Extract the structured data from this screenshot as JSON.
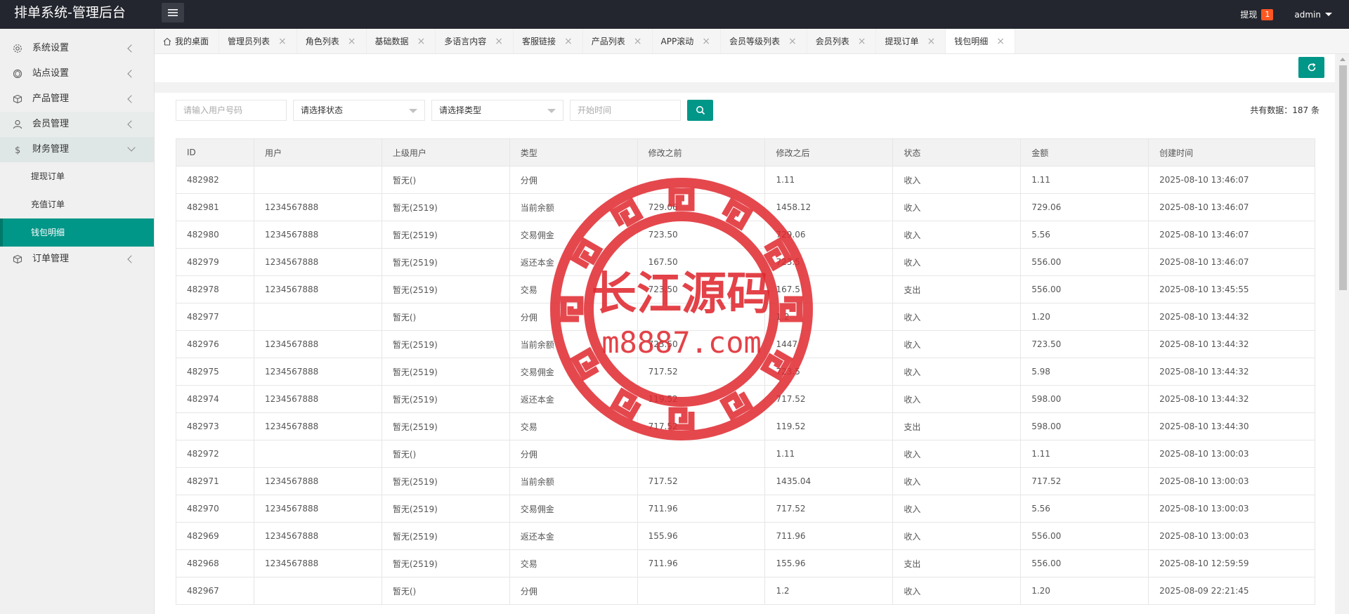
{
  "app": {
    "title": "排单系统-管理后台"
  },
  "topbar": {
    "withdraw_label": "提现",
    "withdraw_badge": "1",
    "user": "admin"
  },
  "sidebar": {
    "groups": [
      {
        "label": "系统设置",
        "icon": "gear-icon"
      },
      {
        "label": "站点设置",
        "icon": "site-icon"
      },
      {
        "label": "产品管理",
        "icon": "box-icon"
      },
      {
        "label": "会员管理",
        "icon": "user-icon"
      },
      {
        "label": "财务管理",
        "icon": "dollar-icon"
      },
      {
        "label": "订单管理",
        "icon": "box-icon"
      }
    ],
    "finance_items": [
      {
        "label": "提现订单"
      },
      {
        "label": "充值订单"
      },
      {
        "label": "钱包明细"
      }
    ]
  },
  "tabs": [
    {
      "label": "我的桌面"
    },
    {
      "label": "管理员列表"
    },
    {
      "label": "角色列表"
    },
    {
      "label": "基础数据"
    },
    {
      "label": "多语言内容"
    },
    {
      "label": "客服链接"
    },
    {
      "label": "产品列表"
    },
    {
      "label": "APP滚动"
    },
    {
      "label": "会员等级列表"
    },
    {
      "label": "会员列表"
    },
    {
      "label": "提现订单"
    },
    {
      "label": "钱包明细"
    }
  ],
  "filters": {
    "user_placeholder": "请输入用户号码",
    "status_select": "请选择状态",
    "type_select": "请选择类型",
    "time_placeholder": "开始时间"
  },
  "total_text": "共有数据：187 条",
  "table": {
    "headers": [
      "ID",
      "用户",
      "上级用户",
      "类型",
      "修改之前",
      "修改之后",
      "状态",
      "金额",
      "创建时间"
    ],
    "rows": [
      [
        "482982",
        "",
        "暂无()",
        "分佣",
        "",
        "1.11",
        "收入",
        "1.11",
        "2025-08-10 13:46:07"
      ],
      [
        "482981",
        "1234567888",
        "暂无(2519)",
        "当前余额",
        "729.06",
        "1458.12",
        "收入",
        "729.06",
        "2025-08-10 13:46:07"
      ],
      [
        "482980",
        "1234567888",
        "暂无(2519)",
        "交易佣金",
        "723.50",
        "729.06",
        "收入",
        "5.56",
        "2025-08-10 13:46:07"
      ],
      [
        "482979",
        "1234567888",
        "暂无(2519)",
        "返还本金",
        "167.50",
        "723.5",
        "收入",
        "556.00",
        "2025-08-10 13:46:07"
      ],
      [
        "482978",
        "1234567888",
        "暂无(2519)",
        "交易",
        "723.50",
        "167.5",
        "支出",
        "556.00",
        "2025-08-10 13:45:55"
      ],
      [
        "482977",
        "",
        "暂无()",
        "分佣",
        "",
        "1.2",
        "收入",
        "1.20",
        "2025-08-10 13:44:32"
      ],
      [
        "482976",
        "1234567888",
        "暂无(2519)",
        "当前余额",
        "723.50",
        "1447",
        "收入",
        "723.50",
        "2025-08-10 13:44:32"
      ],
      [
        "482975",
        "1234567888",
        "暂无(2519)",
        "交易佣金",
        "717.52",
        "723.5",
        "收入",
        "5.98",
        "2025-08-10 13:44:32"
      ],
      [
        "482974",
        "1234567888",
        "暂无(2519)",
        "返还本金",
        "119.52",
        "717.52",
        "收入",
        "598.00",
        "2025-08-10 13:44:32"
      ],
      [
        "482973",
        "1234567888",
        "暂无(2519)",
        "交易",
        "717.52",
        "119.52",
        "支出",
        "598.00",
        "2025-08-10 13:44:30"
      ],
      [
        "482972",
        "",
        "暂无()",
        "分佣",
        "",
        "1.11",
        "收入",
        "1.11",
        "2025-08-10 13:00:03"
      ],
      [
        "482971",
        "1234567888",
        "暂无(2519)",
        "当前余额",
        "717.52",
        "1435.04",
        "收入",
        "717.52",
        "2025-08-10 13:00:03"
      ],
      [
        "482970",
        "1234567888",
        "暂无(2519)",
        "交易佣金",
        "711.96",
        "717.52",
        "收入",
        "5.56",
        "2025-08-10 13:00:03"
      ],
      [
        "482969",
        "1234567888",
        "暂无(2519)",
        "返还本金",
        "155.96",
        "711.96",
        "收入",
        "556.00",
        "2025-08-10 13:00:03"
      ],
      [
        "482968",
        "1234567888",
        "暂无(2519)",
        "交易",
        "711.96",
        "155.96",
        "支出",
        "556.00",
        "2025-08-10 12:59:59"
      ],
      [
        "482967",
        "",
        "暂无()",
        "分佣",
        "",
        "1.2",
        "收入",
        "1.20",
        "2025-08-09 22:21:45"
      ]
    ]
  },
  "watermark": {
    "title": "长江源码",
    "url": "m8887.com",
    "color": "#e0292f"
  },
  "colors": {
    "accent": "#009688",
    "topbar": "#23262e",
    "badge": "#ff5722"
  }
}
